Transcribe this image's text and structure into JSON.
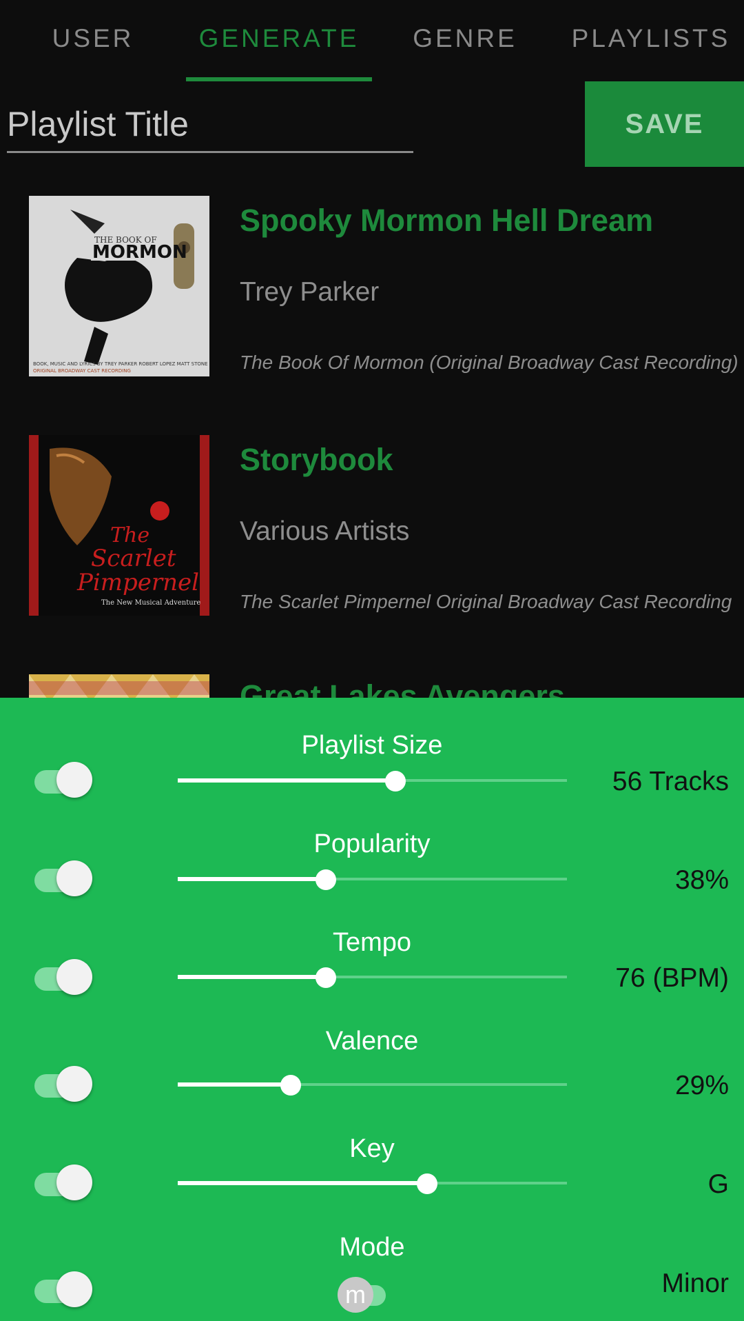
{
  "tabs": [
    {
      "label": "USER",
      "active": false
    },
    {
      "label": "GENERATE",
      "active": true
    },
    {
      "label": "GENRE",
      "active": false
    },
    {
      "label": "PLAYLISTS",
      "active": false
    }
  ],
  "playlist": {
    "title_placeholder": "Playlist Title",
    "save_label": "SAVE"
  },
  "tracks": [
    {
      "title": "Spooky Mormon Hell Dream",
      "artist": "Trey Parker",
      "album": "The Book Of Mormon (Original Broadway Cast Recording)",
      "cover_icon": "album-cover-book-of-mormon"
    },
    {
      "title": "Storybook",
      "artist": "Various Artists",
      "album": "The Scarlet Pimpernel Original Broadway Cast Recording",
      "cover_icon": "album-cover-scarlet-pimpernel"
    },
    {
      "title": "Great Lakes Avengers",
      "artist": "",
      "album": "",
      "cover_icon": "album-cover-partial"
    }
  ],
  "controls": [
    {
      "label": "Playlist Size",
      "value": "56 Tracks",
      "level": 0.56,
      "enabled": true
    },
    {
      "label": "Popularity",
      "value": "38%",
      "level": 0.38,
      "enabled": true
    },
    {
      "label": "Tempo",
      "value": "76 (BPM)",
      "level": 0.38,
      "enabled": true
    },
    {
      "label": "Valence",
      "value": "29%",
      "level": 0.29,
      "enabled": true
    },
    {
      "label": "Key",
      "value": "G",
      "level": 0.64,
      "enabled": true
    }
  ],
  "mode": {
    "label": "Mode",
    "value": "Minor",
    "switch_letter": "m",
    "enabled": true
  },
  "colors": {
    "accent": "#1e8a3c",
    "panel": "#1db954",
    "background": "#0d0d0d"
  }
}
